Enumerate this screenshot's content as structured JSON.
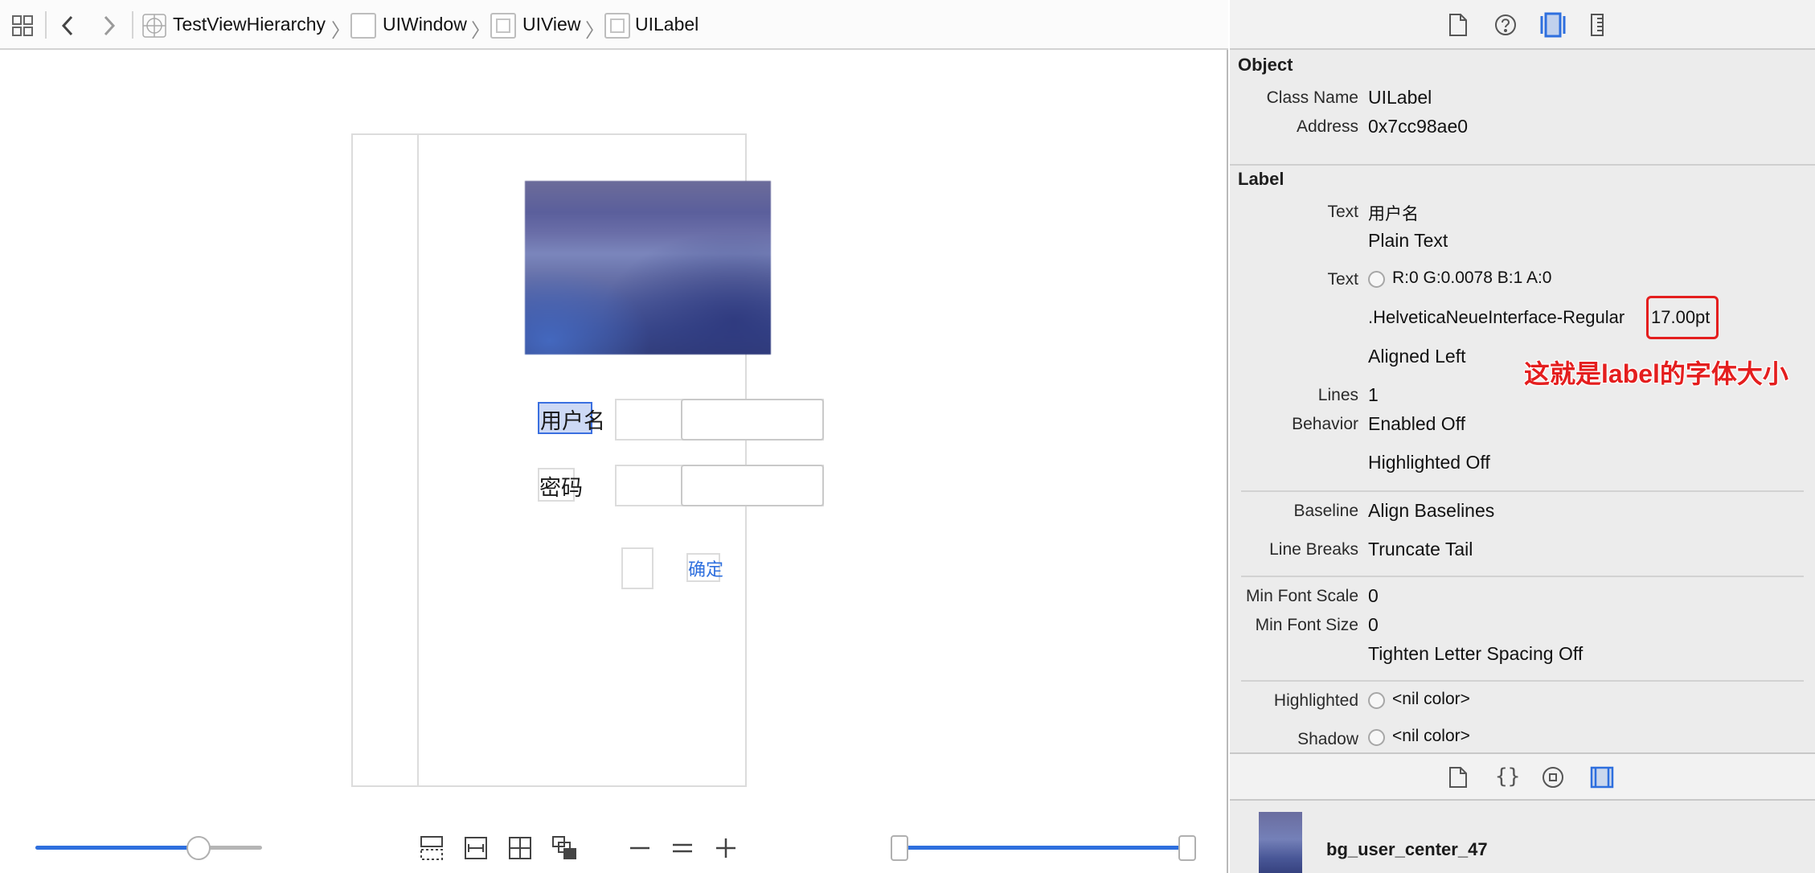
{
  "jumpbar": {
    "crumbs": [
      "TestViewHierarchy",
      "UIWindow",
      "UIView",
      "UILabel"
    ],
    "separator": "〉"
  },
  "canvas": {
    "username_label": "用户名",
    "password_label": "密码",
    "confirm_button": "确定"
  },
  "inspector": {
    "object_section": {
      "title": "Object",
      "class_name_label": "Class Name",
      "class_name_value": "UILabel",
      "address_label": "Address",
      "address_value": "0x7cc98ae0"
    },
    "label_section": {
      "title": "Label",
      "text_label": "Text",
      "text_value": "用户名",
      "text_type": "Plain Text",
      "color_label": "Text",
      "color_value": "R:0 G:0.0078 B:1 A:0",
      "font_name": ".HelveticaNeueInterface-Regular",
      "font_size": "17.00pt",
      "alignment": "Aligned Left",
      "lines_label": "Lines",
      "lines_value": "1",
      "behavior_label": "Behavior",
      "behavior_enabled": "Enabled Off",
      "behavior_highlighted": "Highlighted Off",
      "baseline_label": "Baseline",
      "baseline_value": "Align Baselines",
      "line_breaks_label": "Line Breaks",
      "line_breaks_value": "Truncate Tail",
      "min_font_scale_label": "Min Font Scale",
      "min_font_scale_value": "0",
      "min_font_size_label": "Min Font Size",
      "min_font_size_value": "0",
      "tighten_value": "Tighten Letter Spacing Off",
      "highlighted_label": "Highlighted",
      "highlighted_value": "<nil color>",
      "shadow_label": "Shadow",
      "shadow_value": "<nil color>"
    }
  },
  "annotation": "这就是label的字体大小",
  "library": {
    "item_name": "bg_user_center_47"
  },
  "sliders": {
    "left_fraction": 0.72,
    "right_range": [
      0.0,
      1.0
    ]
  },
  "colors": {
    "accent": "#2e6fde",
    "annotation": "#e41e1e",
    "selection_fill": "#cdd9f5"
  }
}
